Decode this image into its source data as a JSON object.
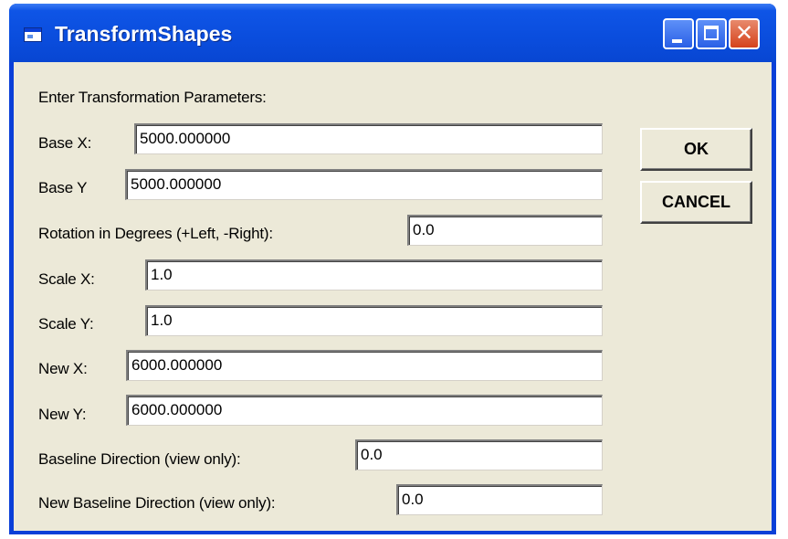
{
  "window": {
    "title": "TransformShapes",
    "controls": {
      "minimize": "minimize",
      "maximize": "maximize",
      "close": "✕"
    }
  },
  "form": {
    "heading": "Enter Transformation Parameters:",
    "base_x": {
      "label": "Base X:",
      "value": "5000.000000"
    },
    "base_y": {
      "label": "Base Y",
      "value": "5000.000000"
    },
    "rotation": {
      "label": "Rotation in Degrees (+Left, -Right):",
      "value": "0.0"
    },
    "scale_x": {
      "label": "Scale X:",
      "value": "1.0"
    },
    "scale_y": {
      "label": "Scale Y:",
      "value": "1.0"
    },
    "new_x": {
      "label": "New X:",
      "value": "6000.000000"
    },
    "new_y": {
      "label": "New Y:",
      "value": "6000.000000"
    },
    "baseline_direction": {
      "label": "Baseline Direction (view only):",
      "value": "0.0"
    },
    "new_baseline_direction": {
      "label": "New Baseline Direction (view only):",
      "value": "0.0"
    }
  },
  "buttons": {
    "ok": "OK",
    "cancel": "CANCEL"
  },
  "colors": {
    "titlebar": "#0a4ddd",
    "client_bg": "#ece9d8",
    "close_button": "#d5421c"
  }
}
